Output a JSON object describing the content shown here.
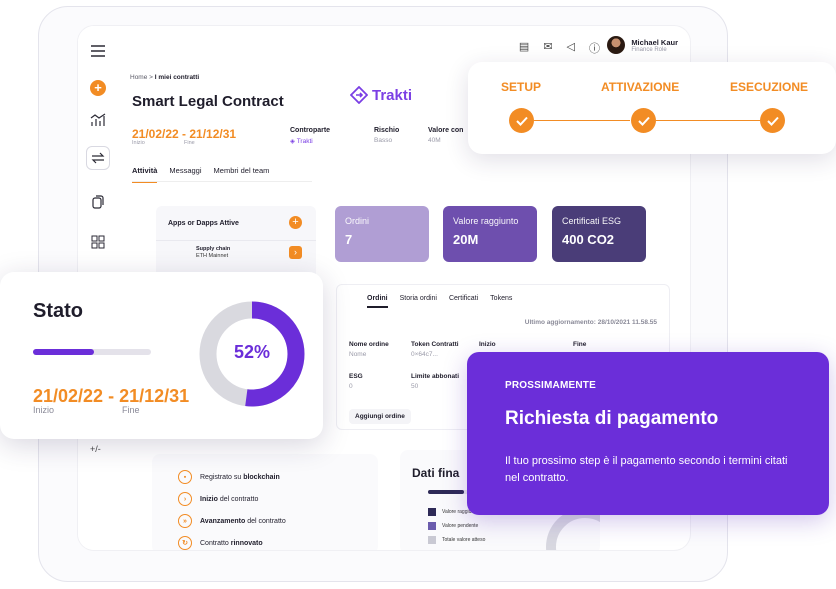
{
  "colors": {
    "accent": "#f28c24",
    "purple": "#6b2ed9",
    "ordini_card": "#b09ed4",
    "valore_card": "#6e4fae",
    "esg_card": "#4a3d78"
  },
  "user": {
    "name": "Michael Kaur",
    "role": "Finance Role"
  },
  "breadcrumb": {
    "home": "Home",
    "sep": " > ",
    "current": "I miei contratti"
  },
  "page_title": "Smart Legal Contract",
  "brand": "Trakti",
  "contract": {
    "dates": "21/02/22 - 21/12/31",
    "start_label": "Inizio",
    "end_label": "Fine",
    "controparte_label": "Controparte",
    "controparte_value": "Trakti",
    "rischio_label": "Rischio",
    "rischio_value": "Basso",
    "valore_label": "Valore con",
    "valore_value": "40M"
  },
  "tabs": [
    "Attività",
    "Messaggi",
    "Membri del team"
  ],
  "apps": {
    "title": "Apps or Dapps Attive",
    "item_name": "Supply chain",
    "item_net": "ETH Mainnet"
  },
  "stats": [
    {
      "label": "Ordini",
      "value": "7"
    },
    {
      "label": "Valore raggiunto",
      "value": "20M"
    },
    {
      "label": "Certificati ESG",
      "value": "400 CO2"
    }
  ],
  "orders": {
    "tabs": [
      "Ordini",
      "Storia ordini",
      "Certificati",
      "Tokens"
    ],
    "updated_label": "Ultimo aggiornamento:",
    "updated_value": "28/10/2021 11.58.55",
    "fields": [
      {
        "k": "Nome ordine",
        "v": "Nome"
      },
      {
        "k": "Token Contratti",
        "v": "0×64c7..."
      },
      {
        "k": "Inizio",
        "v": ""
      },
      {
        "k": "Fine",
        "v": ""
      },
      {
        "k": "ESG",
        "v": "0"
      },
      {
        "k": "Limite abbonati",
        "v": "50"
      }
    ],
    "add_button": "Aggiungi ordine"
  },
  "plusminus": "+/-",
  "timeline": [
    {
      "bold": "",
      "prefix": "Registrato su ",
      "suffix": "blockchain"
    },
    {
      "bold": "Inizio",
      "prefix": "",
      "suffix": " del contratto"
    },
    {
      "bold": "Avanzamento",
      "prefix": "",
      "suffix": " del contratto"
    },
    {
      "bold": "",
      "prefix": "Contratto ",
      "suffix": "rinnovato"
    }
  ],
  "finance": {
    "title": "Dati fina",
    "legend": [
      "Valore raggiunto",
      "Valore pendente",
      "Totale valore atteso"
    ],
    "legend_colors": [
      "#2e2a57",
      "#6b5cad",
      "#c9c9d3"
    ]
  },
  "stepper": {
    "steps": [
      "SETUP",
      "ATTIVAZIONE",
      "ESECUZIONE"
    ]
  },
  "stato": {
    "title": "Stato",
    "progress": 0.52,
    "percent_label": "52%",
    "dates": "21/02/22 - 21/12/31",
    "start_label": "Inizio",
    "end_label": "Fine"
  },
  "payment": {
    "tag": "PROSSIMAMENTE",
    "title": "Richiesta di pagamento",
    "description": "Il tuo prossimo step è il pagamento secondo i termini citati nel contratto."
  }
}
